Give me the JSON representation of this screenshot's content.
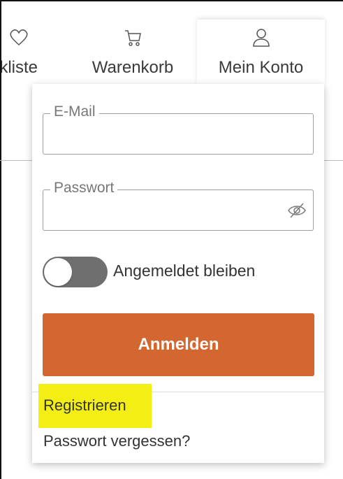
{
  "header": {
    "nav": {
      "wishlist": {
        "label": "Merkliste",
        "icon": "heart-icon"
      },
      "cart": {
        "label": "Warenkorb",
        "icon": "cart-icon"
      },
      "account": {
        "label": "Mein Konto",
        "icon": "user-icon"
      }
    }
  },
  "login": {
    "email": {
      "label": "E-Mail",
      "value": ""
    },
    "password": {
      "label": "Passwort",
      "value": "",
      "visibility_icon": "eye-off-icon"
    },
    "remember": {
      "label": "Angemeldet bleiben",
      "checked": false
    },
    "submit_label": "Anmelden",
    "register_label": "Registrieren",
    "forgot_label": "Passwort vergessen?"
  },
  "colors": {
    "button": "#d4672f",
    "highlight": "#f3ee14",
    "toggle_off": "#6f6f6f"
  }
}
